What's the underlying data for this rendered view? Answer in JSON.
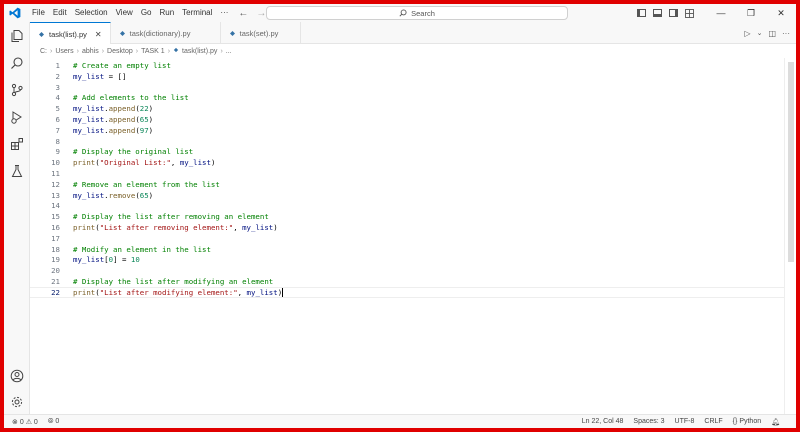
{
  "titlebar": {
    "menu": [
      "File",
      "Edit",
      "Selection",
      "View",
      "Go",
      "Run",
      "Terminal",
      "···"
    ],
    "search_label": "Search"
  },
  "tabs": [
    {
      "label": "task(list).py",
      "active": true
    },
    {
      "label": "task(dictionary).py",
      "active": false
    },
    {
      "label": "task(set).py",
      "active": false
    }
  ],
  "breadcrumb": [
    "C:",
    "Users",
    "abhis",
    "Desktop",
    "TASK 1",
    "task(list).py",
    "..."
  ],
  "editor": {
    "lines": [
      {
        "n": "1",
        "text": "# Create an empty list"
      },
      {
        "n": "2",
        "text": "my_list = []"
      },
      {
        "n": "3",
        "text": ""
      },
      {
        "n": "4",
        "text": "# Add elements to the list"
      },
      {
        "n": "5",
        "text": "my_list.append(22)"
      },
      {
        "n": "6",
        "text": "my_list.append(65)"
      },
      {
        "n": "7",
        "text": "my_list.append(97)"
      },
      {
        "n": "8",
        "text": ""
      },
      {
        "n": "9",
        "text": "# Display the original list"
      },
      {
        "n": "10",
        "text": "print(\"Original List:\", my_list)"
      },
      {
        "n": "11",
        "text": ""
      },
      {
        "n": "12",
        "text": "# Remove an element from the list"
      },
      {
        "n": "13",
        "text": "my_list.remove(65)"
      },
      {
        "n": "14",
        "text": ""
      },
      {
        "n": "15",
        "text": "# Display the list after removing an element"
      },
      {
        "n": "16",
        "text": "print(\"List after removing element:\", my_list)"
      },
      {
        "n": "17",
        "text": ""
      },
      {
        "n": "18",
        "text": "# Modify an element in the list"
      },
      {
        "n": "19",
        "text": "my_list[0] = 10"
      },
      {
        "n": "20",
        "text": ""
      },
      {
        "n": "21",
        "text": "# Display the list after modifying an element"
      },
      {
        "n": "22",
        "text": "print(\"List after modifying element:\", my_list)"
      }
    ],
    "current_line": "22"
  },
  "status": {
    "errors": "0",
    "warnings": "0",
    "ports": "0",
    "position": "Ln 22, Col 48",
    "spaces": "Spaces: 3",
    "encoding": "UTF-8",
    "eol": "CRLF",
    "language": "Python"
  },
  "colors": {
    "border": "#e00000",
    "accent": "#0078d4",
    "comment": "#008000",
    "function": "#795e26",
    "string": "#a31515",
    "number": "#098658",
    "variable": "#001080"
  }
}
